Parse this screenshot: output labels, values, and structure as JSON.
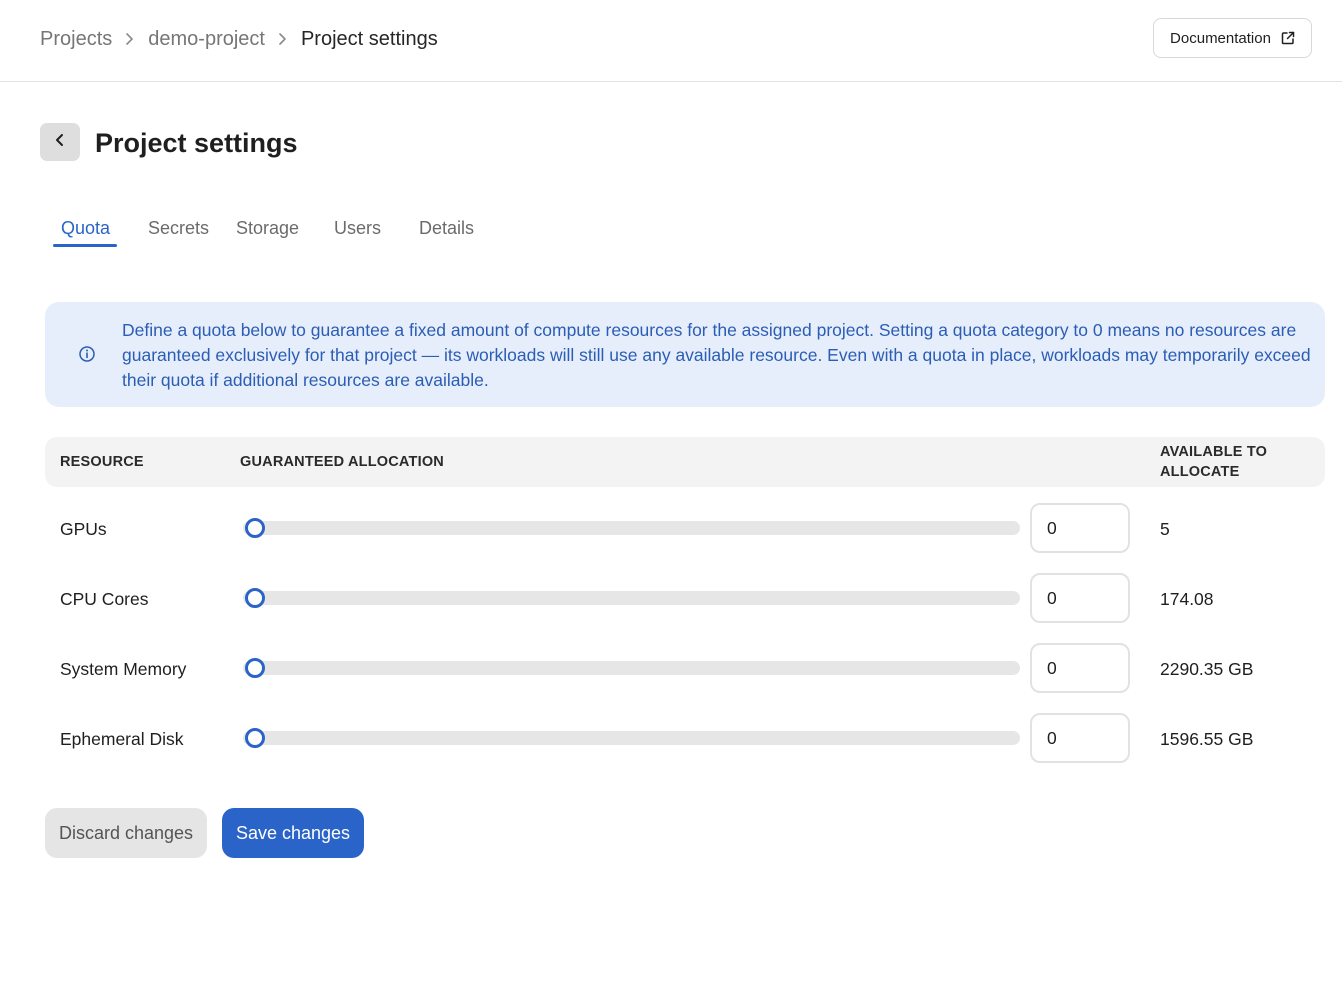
{
  "breadcrumb": {
    "items": [
      "Projects",
      "demo-project"
    ],
    "current": "Project settings"
  },
  "header": {
    "documentation_label": "Documentation",
    "documentation_icon": "external-link-icon"
  },
  "page": {
    "title": "Project settings",
    "back_icon": "chevron-left-icon"
  },
  "tabs": [
    {
      "label": "Quota",
      "active": true
    },
    {
      "label": "Secrets",
      "active": false
    },
    {
      "label": "Storage",
      "active": false
    },
    {
      "label": "Users",
      "active": false
    },
    {
      "label": "Details",
      "active": false
    }
  ],
  "info": {
    "icon": "info-icon",
    "text": "Define a quota below to guarantee a fixed amount of compute resources for the assigned project. Setting a quota category to 0 means no resources are guaranteed exclusively for that project — its workloads will still use any available resource. Even with a quota in place, workloads may temporarily exceed their quota if additional resources are available."
  },
  "table": {
    "headers": {
      "resource": "RESOURCE",
      "allocation": "GUARANTEED ALLOCATION",
      "available": "AVAILABLE TO ALLOCATE"
    },
    "rows": [
      {
        "resource": "GPUs",
        "value": "0",
        "slider_fraction": 0,
        "available": "5"
      },
      {
        "resource": "CPU Cores",
        "value": "0",
        "slider_fraction": 0,
        "available": "174.08"
      },
      {
        "resource": "System Memory",
        "value": "0",
        "slider_fraction": 0,
        "available": "2290.35 GB"
      },
      {
        "resource": "Ephemeral Disk",
        "value": "0",
        "slider_fraction": 0,
        "available": "1596.55 GB"
      }
    ]
  },
  "actions": {
    "discard_label": "Discard changes",
    "save_label": "Save changes"
  },
  "colors": {
    "accent": "#2a64c8",
    "info_bg": "#e7eefb",
    "info_text": "#2a5db5"
  }
}
